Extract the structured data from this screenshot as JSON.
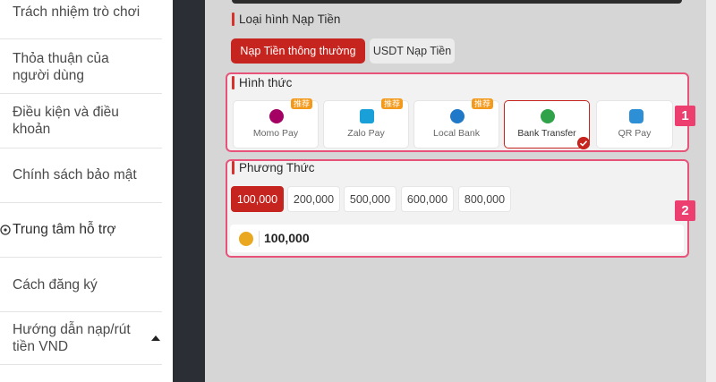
{
  "sidebar": {
    "items": [
      {
        "label": "Trách nhiệm trò chơi"
      },
      {
        "label": "Thỏa thuận của người dùng"
      },
      {
        "label": "Điều kiện và điều khoản"
      },
      {
        "label": "Chính sách bảo mật"
      },
      {
        "label": "Trung tâm hỗ trợ",
        "icon": "help-circle-icon"
      },
      {
        "label": "Cách đăng ký"
      },
      {
        "label": "Hướng dẫn nạp/rút tiền VND",
        "icon": "caret-up-icon"
      }
    ]
  },
  "deposit": {
    "type_title": "Loại hình Nạp Tiền",
    "tabs": [
      {
        "label": "Nạp Tiền thông thường",
        "active": true
      },
      {
        "label": "USDT Nạp Tiền",
        "active": false
      }
    ],
    "method_title": "Hình thức",
    "methods": [
      {
        "label": "Momo Pay",
        "badge": "推荐",
        "icon": "momo-icon",
        "color": "#a50064"
      },
      {
        "label": "Zalo Pay",
        "badge": "推荐",
        "icon": "zalo-icon",
        "color": "#1aa0d8"
      },
      {
        "label": "Local Bank",
        "badge": "推荐",
        "icon": "bank-icon",
        "color": "#1f78c8"
      },
      {
        "label": "Bank Transfer",
        "selected": true,
        "icon": "lbt-icon",
        "color": "#2fa24a"
      },
      {
        "label": "QR Pay",
        "icon": "qr-icon",
        "color": "#2d8fd6"
      }
    ],
    "amount_title": "Phương Thức",
    "amounts": [
      "100,000",
      "200,000",
      "500,000",
      "600,000",
      "800,000"
    ],
    "selected_amount": "100,000",
    "amount_value": "100,000",
    "step_labels": [
      "1",
      "2"
    ]
  },
  "colors": {
    "accent": "#c6251f",
    "highlight_border": "#e8537a",
    "badge": "#f39a1c"
  }
}
